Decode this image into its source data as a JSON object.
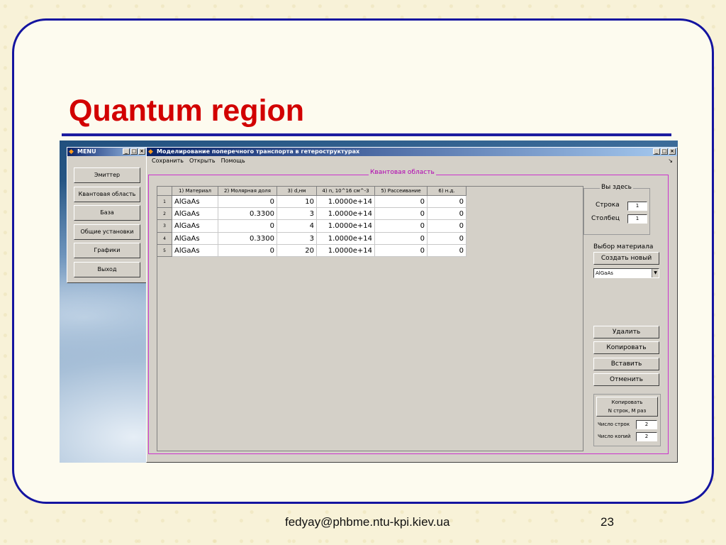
{
  "slide": {
    "title": "Quantum region",
    "footer_email": "fedyay@phbme.ntu-kpi.kiev.ua",
    "page_number": "23",
    "colors": {
      "title": "#d20000",
      "frame": "#1414a0",
      "background": "#f8f2d8"
    }
  },
  "menu_window": {
    "title": "MENU",
    "buttons": [
      "Эмиттер",
      "Квантовая область",
      "База",
      "Общие установки",
      "Графики",
      "Выход"
    ]
  },
  "main_window": {
    "title": "Моделирование поперечного транспорта в гетероструктурах",
    "menubar": [
      "Сохранить",
      "Открыть",
      "Помощь"
    ],
    "menubar_arrow": "↘",
    "frame_title": "Квантовая область",
    "table": {
      "headers": [
        "1) Материал",
        "2) Молярная доля",
        "3) d,нм",
        "4) n, 10^16 см^-3",
        "5) Рассеивание",
        "6) н.д."
      ],
      "rows": [
        {
          "n": "1",
          "cells": [
            "AlGaAs",
            "0",
            "10",
            "1.0000e+14",
            "0",
            "0"
          ]
        },
        {
          "n": "2",
          "cells": [
            "AlGaAs",
            "0.3300",
            "3",
            "1.0000e+14",
            "0",
            "0"
          ]
        },
        {
          "n": "3",
          "cells": [
            "AlGaAs",
            "0",
            "4",
            "1.0000e+14",
            "0",
            "0"
          ]
        },
        {
          "n": "4",
          "cells": [
            "AlGaAs",
            "0.3300",
            "3",
            "1.0000e+14",
            "0",
            "0"
          ]
        },
        {
          "n": "5",
          "cells": [
            "AlGaAs",
            "0",
            "20",
            "1.0000e+14",
            "0",
            "0"
          ]
        }
      ]
    },
    "position_panel": {
      "title": "Вы здесь",
      "row_label": "Строка",
      "row_value": "1",
      "col_label": "Столбец",
      "col_value": "1"
    },
    "material_panel": {
      "title": "Выбор материала",
      "create_button": "Создать новый",
      "selected_material": "AlGaAs"
    },
    "actions": {
      "delete": "Удалить",
      "copy": "Копировать",
      "paste": "Вставить",
      "cancel": "Отменить"
    },
    "copy_panel": {
      "button_line1": "Копировать",
      "button_line2": "N строк, M раз",
      "rows_label": "Число строк",
      "rows_value": "2",
      "copies_label": "Число копий",
      "copies_value": "2"
    }
  }
}
